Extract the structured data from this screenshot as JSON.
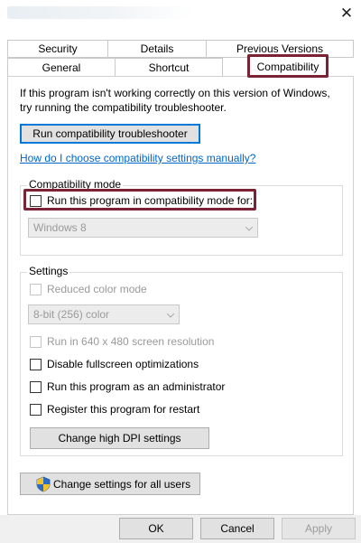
{
  "window": {
    "close_glyph": "✕"
  },
  "tabs": {
    "row1": [
      "Security",
      "Details",
      "Previous Versions"
    ],
    "row2": [
      "General",
      "Shortcut",
      "Compatibility"
    ],
    "selected": "Compatibility"
  },
  "intro": {
    "line1": "If this program isn't working correctly on this version of Windows,",
    "line2": "try running the compatibility troubleshooter."
  },
  "troubleshooter_button": "Run compatibility troubleshooter",
  "help_link": "How do I choose compatibility settings manually?",
  "compat_mode": {
    "title": "Compatibility mode",
    "checkbox_label": "Run this program in compatibility mode for:",
    "checked": false,
    "select_value": "Windows 8"
  },
  "settings": {
    "title": "Settings",
    "reduced_color": {
      "label": "Reduced color mode",
      "checked": false
    },
    "color_select_value": "8-bit (256) color",
    "resolution_640": {
      "label": "Run in 640 x 480 screen resolution",
      "checked": false
    },
    "disable_fullscreen": {
      "label": "Disable fullscreen optimizations",
      "checked": false
    },
    "run_as_admin": {
      "label": "Run this program as an administrator",
      "checked": false
    },
    "register_restart": {
      "label": "Register this program for restart",
      "checked": false
    },
    "dpi_button": "Change high DPI settings"
  },
  "change_all_users_button": "Change settings for all users",
  "footer": {
    "ok": "OK",
    "cancel": "Cancel",
    "apply": "Apply"
  },
  "colors": {
    "highlight": "#7b2334",
    "link": "#0066cc",
    "focus": "#0078d7"
  }
}
